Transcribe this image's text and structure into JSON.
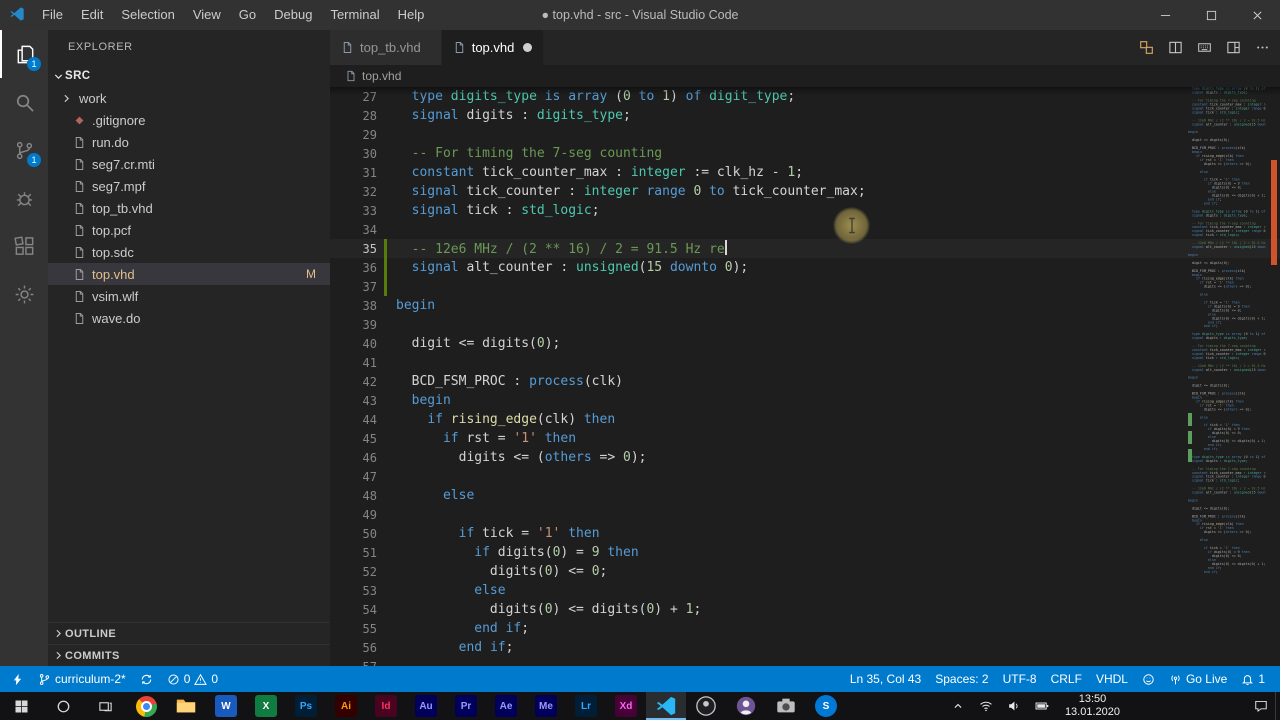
{
  "colors": {
    "accent": "#007acc",
    "status_bar_bg": "#007acc",
    "activity_badge": "#007acc",
    "git_modified": "#e2c08d",
    "selection_bg": "#37373d",
    "comment": "#6a9955",
    "keyword": "#569cd6",
    "type_name": "#4ec9b0",
    "number": "#b5cea8",
    "string": "#ce9178",
    "function_name": "#dcdcaa",
    "gutter_added": "#587c0c",
    "overview_marker": "#d0532b"
  },
  "title_bar": {
    "menus": [
      "File",
      "Edit",
      "Selection",
      "View",
      "Go",
      "Debug",
      "Terminal",
      "Help"
    ],
    "title": "● top.vhd - src - Visual Studio Code"
  },
  "activity_bar": {
    "items": [
      {
        "name": "explorer",
        "icon": "files",
        "active": true,
        "badge": "1"
      },
      {
        "name": "search",
        "icon": "search"
      },
      {
        "name": "source-control",
        "icon": "scm",
        "badge": "1"
      },
      {
        "name": "run-debug",
        "icon": "debug"
      },
      {
        "name": "extensions",
        "icon": "extensions"
      },
      {
        "name": "settings",
        "icon": "gear"
      }
    ]
  },
  "explorer": {
    "title": "EXPLORER",
    "section_label": "SRC",
    "files": [
      {
        "name": "work",
        "kind": "folder"
      },
      {
        "name": ".gitignore",
        "kind": "git"
      },
      {
        "name": "run.do",
        "kind": "file"
      },
      {
        "name": "seg7.cr.mti",
        "kind": "file"
      },
      {
        "name": "seg7.mpf",
        "kind": "file"
      },
      {
        "name": "top_tb.vhd",
        "kind": "file"
      },
      {
        "name": "top.pcf",
        "kind": "file"
      },
      {
        "name": "top.sdc",
        "kind": "file"
      },
      {
        "name": "top.vhd",
        "kind": "file",
        "selected": true,
        "git_status": "M"
      },
      {
        "name": "vsim.wlf",
        "kind": "file"
      },
      {
        "name": "wave.do",
        "kind": "file"
      }
    ],
    "bottom_sections": [
      {
        "label": "OUTLINE"
      },
      {
        "label": "COMMITS"
      }
    ]
  },
  "editor": {
    "tabs": [
      {
        "label": "top_tb.vhd",
        "active": false,
        "dirty": false
      },
      {
        "label": "top.vhd",
        "active": true,
        "dirty": true
      }
    ],
    "actions": [
      {
        "name": "open-changes",
        "icon": "diff"
      },
      {
        "name": "split-editor",
        "icon": "split"
      },
      {
        "name": "keyboard-shortcuts",
        "icon": "keyboard"
      },
      {
        "name": "editor-layout",
        "icon": "layout"
      },
      {
        "name": "more-actions",
        "icon": "more"
      }
    ],
    "breadcrumb": "top.vhd",
    "code": {
      "first_line": 27,
      "cursor_line": 35,
      "cursor_col": 43,
      "changed_lines": [
        35,
        36,
        37
      ],
      "lines": [
        {
          "n": 27,
          "t": [
            [
              "  ",
              "pl"
            ],
            [
              "type",
              "kw"
            ],
            [
              " ",
              "pl"
            ],
            [
              "digits_type",
              "ty"
            ],
            [
              " ",
              "pl"
            ],
            [
              "is",
              "kw"
            ],
            [
              " ",
              "pl"
            ],
            [
              "array",
              "kw"
            ],
            [
              " (",
              "pl"
            ],
            [
              "0",
              "nu"
            ],
            [
              " ",
              "pl"
            ],
            [
              "to",
              "kw"
            ],
            [
              " ",
              "pl"
            ],
            [
              "1",
              "nu"
            ],
            [
              ") ",
              "pl"
            ],
            [
              "of",
              "kw"
            ],
            [
              " ",
              "pl"
            ],
            [
              "digit_type",
              "ty"
            ],
            [
              ";",
              "pl"
            ]
          ]
        },
        {
          "n": 28,
          "t": [
            [
              "  ",
              "pl"
            ],
            [
              "signal",
              "kw"
            ],
            [
              " digits : ",
              "pl"
            ],
            [
              "digits_type",
              "ty"
            ],
            [
              ";",
              "pl"
            ]
          ]
        },
        {
          "n": 29,
          "t": []
        },
        {
          "n": 30,
          "t": [
            [
              "  ",
              "pl"
            ],
            [
              "-- For timing the 7-seg counting",
              "cm"
            ]
          ]
        },
        {
          "n": 31,
          "t": [
            [
              "  ",
              "pl"
            ],
            [
              "constant",
              "kw"
            ],
            [
              " tick_counter_max : ",
              "pl"
            ],
            [
              "integer",
              "ty"
            ],
            [
              " := clk_hz - ",
              "pl"
            ],
            [
              "1",
              "nu"
            ],
            [
              ";",
              "pl"
            ]
          ]
        },
        {
          "n": 32,
          "t": [
            [
              "  ",
              "pl"
            ],
            [
              "signal",
              "kw"
            ],
            [
              " tick_counter : ",
              "pl"
            ],
            [
              "integer",
              "ty"
            ],
            [
              " ",
              "pl"
            ],
            [
              "range",
              "kw"
            ],
            [
              " ",
              "pl"
            ],
            [
              "0",
              "nu"
            ],
            [
              " ",
              "pl"
            ],
            [
              "to",
              "kw"
            ],
            [
              " tick_counter_max;",
              "pl"
            ]
          ]
        },
        {
          "n": 33,
          "t": [
            [
              "  ",
              "pl"
            ],
            [
              "signal",
              "kw"
            ],
            [
              " tick : ",
              "pl"
            ],
            [
              "std_logic",
              "ty"
            ],
            [
              ";",
              "pl"
            ]
          ]
        },
        {
          "n": 34,
          "t": []
        },
        {
          "n": 35,
          "t": [
            [
              "  ",
              "pl"
            ],
            [
              "-- 12e6 MHz / (2 ** 16) / 2 = 91.5 Hz re",
              "cm"
            ]
          ]
        },
        {
          "n": 36,
          "t": [
            [
              "  ",
              "pl"
            ],
            [
              "signal",
              "kw"
            ],
            [
              " alt_counter : ",
              "pl"
            ],
            [
              "unsigned",
              "ty"
            ],
            [
              "(",
              "pl"
            ],
            [
              "15",
              "nu"
            ],
            [
              " ",
              "pl"
            ],
            [
              "downto",
              "kw"
            ],
            [
              " ",
              "pl"
            ],
            [
              "0",
              "nu"
            ],
            [
              ");",
              "pl"
            ]
          ]
        },
        {
          "n": 37,
          "t": []
        },
        {
          "n": 38,
          "t": [
            [
              "begin",
              "kw"
            ]
          ]
        },
        {
          "n": 39,
          "t": []
        },
        {
          "n": 40,
          "t": [
            [
              "  digit <= digits(",
              "pl"
            ],
            [
              "0",
              "nu"
            ],
            [
              ");",
              "pl"
            ]
          ]
        },
        {
          "n": 41,
          "t": []
        },
        {
          "n": 42,
          "t": [
            [
              "  BCD_FSM_PROC : ",
              "pl"
            ],
            [
              "process",
              "kw"
            ],
            [
              "(clk)",
              "pl"
            ]
          ]
        },
        {
          "n": 43,
          "t": [
            [
              "  ",
              "pl"
            ],
            [
              "begin",
              "kw"
            ]
          ]
        },
        {
          "n": 44,
          "t": [
            [
              "    ",
              "pl"
            ],
            [
              "if",
              "kw"
            ],
            [
              " ",
              "pl"
            ],
            [
              "rising_edge",
              "fn"
            ],
            [
              "(clk) ",
              "pl"
            ],
            [
              "then",
              "kw"
            ]
          ]
        },
        {
          "n": 45,
          "t": [
            [
              "      ",
              "pl"
            ],
            [
              "if",
              "kw"
            ],
            [
              " rst = ",
              "pl"
            ],
            [
              "'1'",
              "st"
            ],
            [
              " ",
              "pl"
            ],
            [
              "then",
              "kw"
            ]
          ]
        },
        {
          "n": 46,
          "t": [
            [
              "        digits <= (",
              "pl"
            ],
            [
              "others",
              "kw"
            ],
            [
              " => ",
              "pl"
            ],
            [
              "0",
              "nu"
            ],
            [
              ");",
              "pl"
            ]
          ]
        },
        {
          "n": 47,
          "t": []
        },
        {
          "n": 48,
          "t": [
            [
              "      ",
              "pl"
            ],
            [
              "else",
              "kw"
            ]
          ]
        },
        {
          "n": 49,
          "t": []
        },
        {
          "n": 50,
          "t": [
            [
              "        ",
              "pl"
            ],
            [
              "if",
              "kw"
            ],
            [
              " tick = ",
              "pl"
            ],
            [
              "'1'",
              "st"
            ],
            [
              " ",
              "pl"
            ],
            [
              "then",
              "kw"
            ]
          ]
        },
        {
          "n": 51,
          "t": [
            [
              "          ",
              "pl"
            ],
            [
              "if",
              "kw"
            ],
            [
              " digits(",
              "pl"
            ],
            [
              "0",
              "nu"
            ],
            [
              ") = ",
              "pl"
            ],
            [
              "9",
              "nu"
            ],
            [
              " ",
              "pl"
            ],
            [
              "then",
              "kw"
            ]
          ]
        },
        {
          "n": 52,
          "t": [
            [
              "            digits(",
              "pl"
            ],
            [
              "0",
              "nu"
            ],
            [
              ") <= ",
              "pl"
            ],
            [
              "0",
              "nu"
            ],
            [
              ";",
              "pl"
            ]
          ]
        },
        {
          "n": 53,
          "t": [
            [
              "          ",
              "pl"
            ],
            [
              "else",
              "kw"
            ]
          ]
        },
        {
          "n": 54,
          "t": [
            [
              "            digits(",
              "pl"
            ],
            [
              "0",
              "nu"
            ],
            [
              ") <= digits(",
              "pl"
            ],
            [
              "0",
              "nu"
            ],
            [
              ") + ",
              "pl"
            ],
            [
              "1",
              "nu"
            ],
            [
              ";",
              "pl"
            ]
          ]
        },
        {
          "n": 55,
          "t": [
            [
              "          ",
              "pl"
            ],
            [
              "end",
              "kw"
            ],
            [
              " ",
              "pl"
            ],
            [
              "if",
              "kw"
            ],
            [
              ";",
              "pl"
            ]
          ]
        },
        {
          "n": 56,
          "t": [
            [
              "        ",
              "pl"
            ],
            [
              "end",
              "kw"
            ],
            [
              " ",
              "pl"
            ],
            [
              "if",
              "kw"
            ],
            [
              ";",
              "pl"
            ]
          ]
        },
        {
          "n": 57,
          "t": []
        }
      ]
    }
  },
  "status_bar": {
    "left": [
      {
        "type": "icon",
        "icon": "zap",
        "name": "live-share-button"
      },
      {
        "type": "icon-label",
        "icon": "branch",
        "label": "curriculum-2*",
        "name": "git-branch-button"
      },
      {
        "type": "icon",
        "icon": "sync",
        "name": "sync-changes-button"
      },
      {
        "type": "problems",
        "errors": "0",
        "warnings": "0",
        "name": "problems-button"
      }
    ],
    "right": [
      {
        "type": "label",
        "label": "Ln 35, Col 43",
        "name": "cursor-position-button"
      },
      {
        "type": "label",
        "label": "Spaces: 2",
        "name": "indentation-button"
      },
      {
        "type": "label",
        "label": "UTF-8",
        "name": "encoding-button"
      },
      {
        "type": "label",
        "label": "CRLF",
        "name": "eol-button"
      },
      {
        "type": "label",
        "label": "VHDL",
        "name": "language-mode-button"
      },
      {
        "type": "icon",
        "icon": "smiley",
        "name": "feedback-button"
      },
      {
        "type": "icon-label",
        "icon": "broadcast",
        "label": "Go Live",
        "name": "go-live-button"
      },
      {
        "type": "icon-label",
        "icon": "bell",
        "label": "1",
        "name": "notifications-button"
      }
    ]
  },
  "taskbar": {
    "apps": [
      {
        "id": "chrome"
      },
      {
        "id": "file-explorer"
      },
      {
        "id": "word",
        "text": "W",
        "bg": "#185abd",
        "fg": "#ffffff"
      },
      {
        "id": "excel",
        "text": "X",
        "bg": "#107c41",
        "fg": "#ffffff"
      },
      {
        "id": "photoshop",
        "text": "Ps",
        "bg": "#001e36",
        "fg": "#31a8ff"
      },
      {
        "id": "illustrator",
        "text": "Ai",
        "bg": "#330000",
        "fg": "#ff9a00"
      },
      {
        "id": "indesign",
        "text": "Id",
        "bg": "#49021f",
        "fg": "#ff3366"
      },
      {
        "id": "audition",
        "text": "Au",
        "bg": "#00005b",
        "fg": "#9999ff"
      },
      {
        "id": "premiere",
        "text": "Pr",
        "bg": "#00005b",
        "fg": "#9999ff"
      },
      {
        "id": "after-effects",
        "text": "Ae",
        "bg": "#00005b",
        "fg": "#9999ff"
      },
      {
        "id": "media-encoder",
        "text": "Me",
        "bg": "#00005b",
        "fg": "#9999ff"
      },
      {
        "id": "lightroom",
        "text": "Lr",
        "bg": "#001e36",
        "fg": "#31a8ff"
      },
      {
        "id": "xd",
        "text": "Xd",
        "bg": "#470137",
        "fg": "#ff61f6"
      },
      {
        "id": "vscode",
        "active": true
      },
      {
        "id": "obs"
      },
      {
        "id": "github"
      },
      {
        "id": "camera"
      },
      {
        "id": "skype",
        "text": "S",
        "bg": "#0078d4",
        "fg": "#ffffff",
        "round": true
      }
    ],
    "tray": {
      "items": [
        {
          "icon": "caretUp",
          "name": "tray-expand-button"
        },
        {
          "icon": "wifi",
          "name": "network-tray-icon"
        },
        {
          "icon": "speaker",
          "name": "volume-tray-icon"
        },
        {
          "icon": "battery",
          "name": "battery-tray-icon"
        }
      ],
      "time": "13:50",
      "date": "13.01.2020"
    }
  }
}
